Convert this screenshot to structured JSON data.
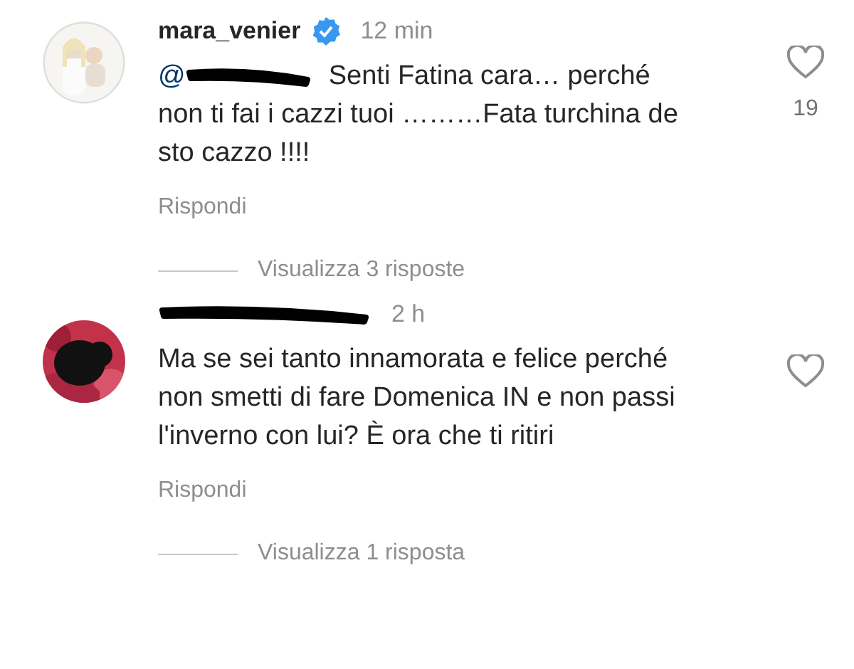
{
  "comments": [
    {
      "username": "mara_venier",
      "verified": true,
      "time": "12 min",
      "mention": "@",
      "text": "Senti Fatina cara… perché non ti fai i cazzi tuoi ………Fata turchina de sto cazzo !!!!",
      "likes": "19",
      "liked": false,
      "reply": "Rispondi",
      "view_replies": "Visualizza 3 risposte"
    },
    {
      "time": "2 h",
      "text": "Ma se sei tanto innamorata e felice perché non smetti di fare Domenica IN e non passi l'inverno con lui? È ora che ti ritiri",
      "liked": false,
      "reply": "Rispondi",
      "view_replies": "Visualizza 1 risposta"
    }
  ]
}
